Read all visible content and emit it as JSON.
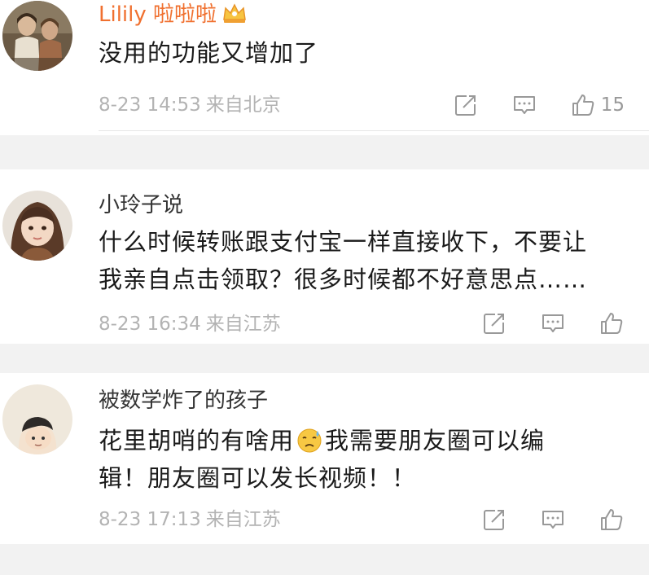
{
  "comments": [
    {
      "username": "Lilily 啦啦啦",
      "text": "没用的功能又增加了",
      "date": "8-23 14:53",
      "source": "来自北京",
      "likes": "15",
      "avatar_icon": "avatar-two-women-icon",
      "badge_icon": "crown-vip-icon"
    },
    {
      "username": "小玲子说",
      "text_lines": [
        "什么时候转账跟支付宝一样直接收下，不要让",
        "我亲自点击领取？很多时候都不好意思点……"
      ],
      "date": "8-23 16:34",
      "source": "来自江苏",
      "likes": "",
      "avatar_icon": "avatar-girl-bangs-icon"
    },
    {
      "username": "被数学炸了的孩子",
      "text_part1": "花里胡哨的有啥用",
      "text_part2": "我需要朋友圈可以编",
      "text_line2": "辑！朋友圈可以发长视频！！",
      "date": "8-23 17:13",
      "source": "来自江苏",
      "likes": "",
      "avatar_icon": "avatar-cartoon-boy-icon",
      "emoji_icon": "sweat-face-emoji"
    }
  ],
  "colors": {
    "background": "#f2f2f2",
    "vip_name": "#f0702f",
    "meta_text": "#b3b3b3",
    "icon": "#999999"
  }
}
